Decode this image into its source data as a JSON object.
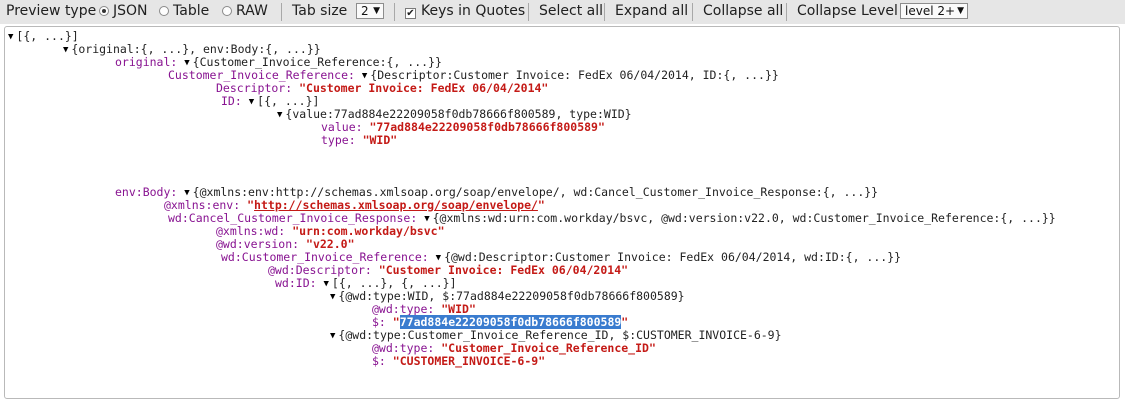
{
  "toolbar": {
    "preview_type_label": "Preview type",
    "options": [
      "JSON",
      "Table",
      "RAW"
    ],
    "selected_option": "JSON",
    "tab_size_label": "Tab size",
    "tab_size_value": "2",
    "keys_in_quotes_label": "Keys in Quotes",
    "keys_in_quotes_checked": true,
    "select_all_label": "Select all",
    "expand_all_label": "Expand all",
    "collapse_all_label": "Collapse all",
    "collapse_level_label": "Collapse Level",
    "collapse_level_value": "level 2+"
  },
  "tree": {
    "root_summary": "[{, ...}]",
    "obj_summary": "{original:{, ...}, env:Body:{, ...}}",
    "original_key": "original:",
    "original_summary": "{Customer_Invoice_Reference:{, ...}}",
    "cir_key": "Customer_Invoice_Reference:",
    "cir_summary": "{Descriptor:Customer Invoice: FedEx 06/04/2014, ID:{, ...}}",
    "descriptor_key": "Descriptor:",
    "descriptor_value": "\"Customer Invoice: FedEx 06/04/2014\"",
    "id_key": "ID:",
    "id_summary": "[{, ...}]",
    "id_item_summary": "{value:77ad884e22209058f0db78666f800589, type:WID}",
    "value_key": "value:",
    "value_value": "\"77ad884e22209058f0db78666f800589\"",
    "type_key": "type:",
    "type_value": "\"WID\"",
    "envbody_key": "env:Body:",
    "envbody_summary": "{@xmlns:env:http://schemas.xmlsoap.org/soap/envelope/, wd:Cancel_Customer_Invoice_Response:{, ...}}",
    "xmlns_env_key": "@xmlns:env:",
    "xmlns_env_q1": "\"",
    "xmlns_env_url": "http://schemas.xmlsoap.org/soap/envelope/",
    "xmlns_env_q2": "\"",
    "ccir_key": "wd:Cancel_Customer_Invoice_Response:",
    "ccir_summary": "{@xmlns:wd:urn:com.workday/bsvc, @wd:version:v22.0, wd:Customer_Invoice_Reference:{, ...}}",
    "xmlns_wd_key": "@xmlns:wd:",
    "xmlns_wd_value": "\"urn:com.workday/bsvc\"",
    "wd_version_key": "@wd:version:",
    "wd_version_value": "\"v22.0\"",
    "wdcir_key": "wd:Customer_Invoice_Reference:",
    "wdcir_summary": "{@wd:Descriptor:Customer Invoice: FedEx 06/04/2014, wd:ID:{, ...}}",
    "wd_descriptor_key": "@wd:Descriptor:",
    "wd_descriptor_value": "\"Customer Invoice: FedEx 06/04/2014\"",
    "wdid_key": "wd:ID:",
    "wdid_summary": "[{, ...}, {, ...}]",
    "wdid0_summary": "{@wd:type:WID, $:77ad884e22209058f0db78666f800589}",
    "wdid0_type_key": "@wd:type:",
    "wdid0_type_value": "\"WID\"",
    "wdid0_dollar_key": "$:",
    "wdid0_q1": "\"",
    "wdid0_dollar_value": "77ad884e22209058f0db78666f800589",
    "wdid0_q2": "\"",
    "wdid1_summary": "{@wd:type:Customer_Invoice_Reference_ID, $:CUSTOMER_INVOICE-6-9}",
    "wdid1_type_key": "@wd:type:",
    "wdid1_type_value": "\"Customer_Invoice_Reference_ID\"",
    "wdid1_dollar_key": "$:",
    "wdid1_dollar_value": "\"CUSTOMER_INVOICE-6-9\""
  },
  "icons": {
    "expanded": "▼",
    "dropdown": "▼",
    "check": "✔"
  },
  "colors": {
    "key": "#881391",
    "string": "#c41a16",
    "selection": "#3a7ccf"
  }
}
